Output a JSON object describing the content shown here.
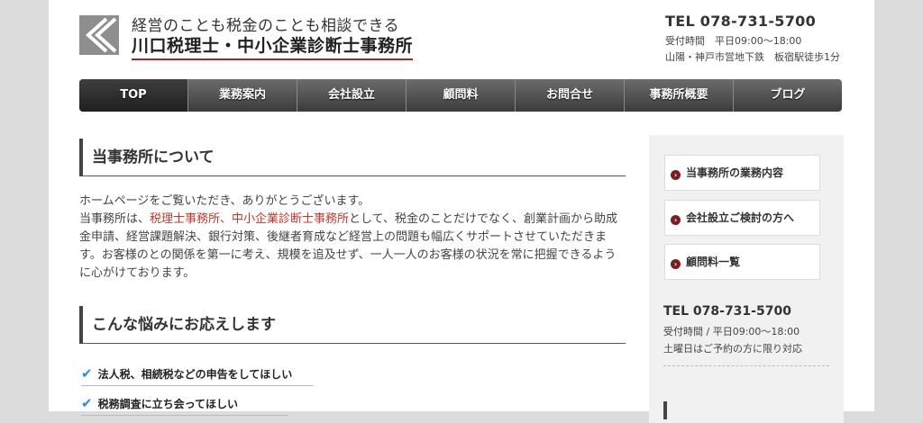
{
  "header": {
    "tagline": "経営のことも税金のことも相談できる",
    "brand": "川口税理士・中小企業診断士事務所",
    "tel": "TEL 078-731-5700",
    "hours": "受付時間　平日09:00～18:00",
    "access": "山陽・神戸市営地下鉄　板宿駅徒歩1分"
  },
  "nav": {
    "items": [
      "TOP",
      "業務案内",
      "会社設立",
      "顧問料",
      "お問合せ",
      "事務所概要",
      "ブログ"
    ]
  },
  "main": {
    "section1_title": "当事務所について",
    "intro_line1": "ホームページをご覧いただき、ありがとうございます。",
    "intro_pre": "当事務所は、",
    "intro_highlight": "税理士事務所、中小企業診断士事務所",
    "intro_post": "として、税金のことだけでなく、創業計画から助成金申請、経営課題解決、銀行対策、後継者育成など経営上の問題も幅広くサポートさせていただきます。お客様のとの関係を第一に考え、規模を追及せず、一人一人のお客様の状況を常に把握できるように心がけております。",
    "section2_title": "こんな悩みにお応えします",
    "checks": [
      "法人税、相続税などの申告をしてほしい",
      "税務調査に立ち会ってほしい"
    ]
  },
  "sidebar": {
    "links": [
      "当事務所の業務内容",
      "会社設立ご検討の方へ",
      "顧問料一覧"
    ],
    "tel": "TEL 078-731-5700",
    "hours": "受付時間 / 平日09:00～18:00",
    "note": "土曜日はご予約の方に限り対応"
  },
  "icons": {
    "logo": "chevron-logo-icon",
    "bullet": "chevron-right-icon",
    "check": "check-icon"
  },
  "colors": {
    "accent_red": "#b22222",
    "highlight": "#c0392b",
    "check_blue": "#2a8fd6",
    "bullet_dark_red": "#7a1f1f"
  }
}
